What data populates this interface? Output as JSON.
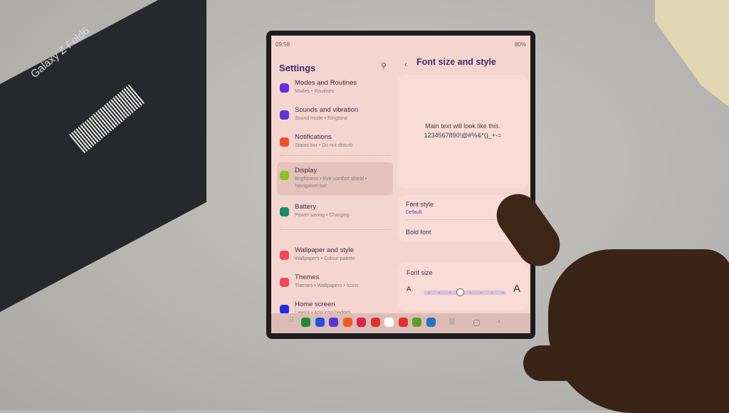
{
  "box": {
    "label": "Galaxy Z Fold6"
  },
  "status": {
    "time": "09:58",
    "battery": "80%"
  },
  "settings": {
    "title": "Settings",
    "items": [
      {
        "title": "Modes and Routines",
        "subtitle": "Modes • Routines",
        "icon": "modes-icon",
        "color": "#6a2de0"
      },
      {
        "title": "Sounds and vibration",
        "subtitle": "Sound mode • Ringtone",
        "icon": "speaker-icon",
        "color": "#5a35d8"
      },
      {
        "title": "Notifications",
        "subtitle": "Status bar • Do not disturb",
        "icon": "notification-icon",
        "color": "#f0502a"
      },
      {
        "title": "Display",
        "subtitle": "Brightness • Eye comfort shield • Navigation bar",
        "icon": "sun-icon",
        "color": "#8cc21e",
        "selected": true
      },
      {
        "title": "Battery",
        "subtitle": "Power saving • Charging",
        "icon": "battery-icon",
        "color": "#1a8a6a"
      },
      {
        "title": "Wallpaper and style",
        "subtitle": "Wallpapers • Colour palette",
        "icon": "wallpaper-icon",
        "color": "#f04858"
      },
      {
        "title": "Themes",
        "subtitle": "Themes • Wallpapers • Icons",
        "icon": "themes-icon",
        "color": "#f04858"
      },
      {
        "title": "Home screen",
        "subtitle": "Layout • App icon badges",
        "icon": "home-icon",
        "color": "#2030e0"
      }
    ]
  },
  "font_page": {
    "title": "Font size and style",
    "preview_line1": "Main text will look like this.",
    "preview_line2": "1234567890!@#%&*()_+-=",
    "font_style_label": "Font style",
    "font_style_value": "Default",
    "bold_font_label": "Bold font",
    "bold_font_on": false,
    "font_size_label": "Font size",
    "small_a": "A",
    "large_a": "A",
    "font_size_level": 4,
    "font_size_steps": 8
  },
  "dock_colors": [
    "#1e8a3a",
    "#2050e0",
    "#5a35d8",
    "#f05a20",
    "#e02050",
    "#e03030",
    "#ffffff",
    "#e03030",
    "#5aa02a",
    "#2a70c8"
  ]
}
